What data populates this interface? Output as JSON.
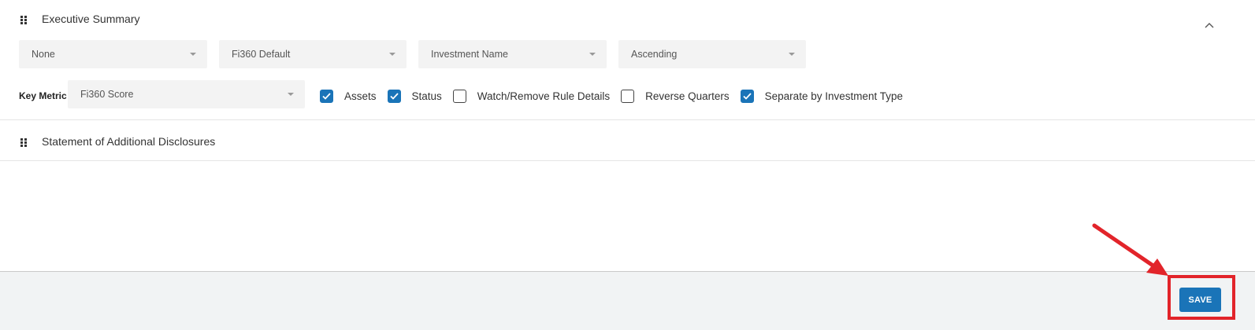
{
  "executive_summary": {
    "title": "Executive Summary",
    "dropdowns": [
      "None",
      "Fi360 Default",
      "Investment Name",
      "Ascending"
    ],
    "key_metric_label": "Key Metric",
    "key_metric_value": "Fi360 Score",
    "checkboxes": [
      {
        "label": "Assets",
        "checked": true
      },
      {
        "label": "Status",
        "checked": true
      },
      {
        "label": "Watch/Remove Rule Details",
        "checked": false
      },
      {
        "label": "Reverse Quarters",
        "checked": false
      },
      {
        "label": "Separate by Investment Type",
        "checked": true
      }
    ]
  },
  "additional_disclosures": {
    "title": "Statement of Additional Disclosures"
  },
  "footer": {
    "save_label": "SAVE"
  },
  "colors": {
    "accent": "#1a74b8",
    "annotation": "#e2242a"
  },
  "icons": {
    "drag_handle": "grip-icon",
    "collapse": "chevron-up-icon",
    "check": "check-icon",
    "dropdown": "caret-down-icon"
  }
}
